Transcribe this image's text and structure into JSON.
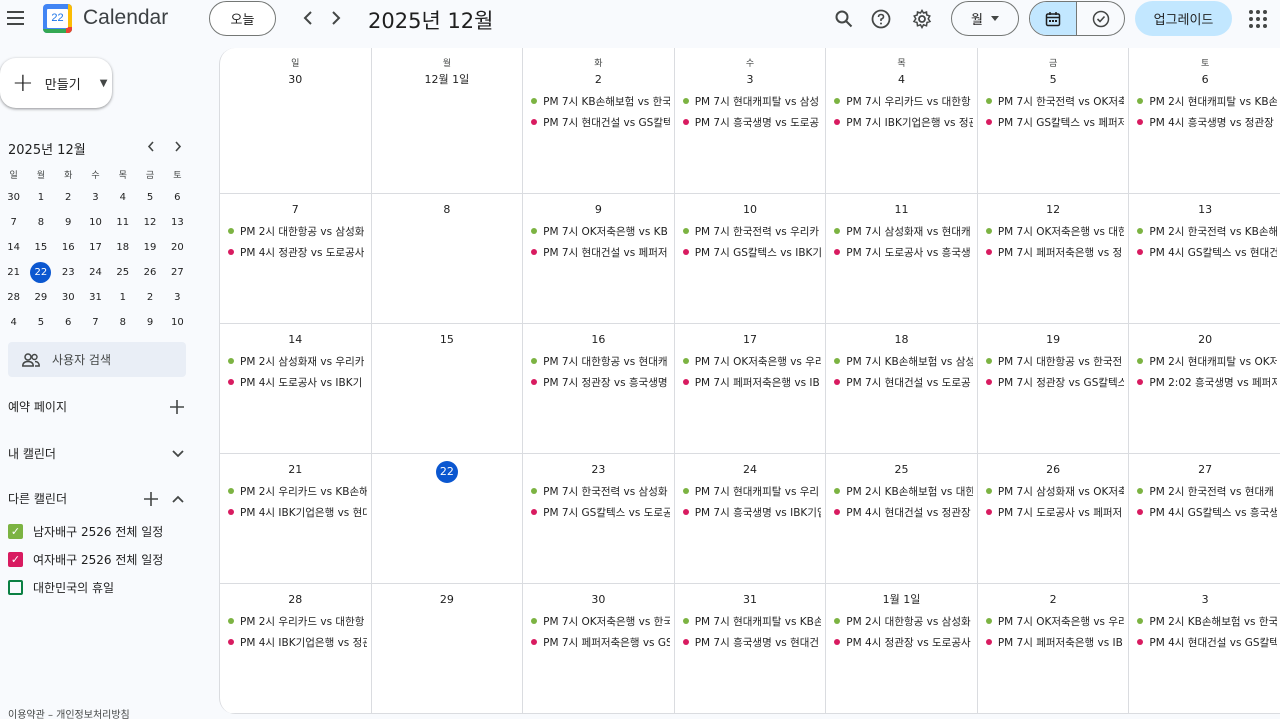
{
  "header": {
    "app_title": "Calendar",
    "logo_day": "22",
    "today_label": "오늘",
    "current_period": "2025년 12월",
    "view_label": "월",
    "upgrade_label": "업그레이드"
  },
  "sidebar": {
    "create_label": "만들기",
    "mini_title": "2025년 12월",
    "mini_weekdays": [
      "일",
      "월",
      "화",
      "수",
      "목",
      "금",
      "토"
    ],
    "mini_weeks": [
      [
        "30",
        "1",
        "2",
        "3",
        "4",
        "5",
        "6"
      ],
      [
        "7",
        "8",
        "9",
        "10",
        "11",
        "12",
        "13"
      ],
      [
        "14",
        "15",
        "16",
        "17",
        "18",
        "19",
        "20"
      ],
      [
        "21",
        "22",
        "23",
        "24",
        "25",
        "26",
        "27"
      ],
      [
        "28",
        "29",
        "30",
        "31",
        "1",
        "2",
        "3"
      ],
      [
        "4",
        "5",
        "6",
        "7",
        "8",
        "9",
        "10"
      ]
    ],
    "people_search": "사용자 검색",
    "booking_pages": "예약 페이지",
    "my_calendars": "내 캘린더",
    "other_calendars": "다른 캘린더",
    "calendars": [
      {
        "label": "남자배구 2526 전체 일정",
        "color": "#7cb342",
        "checked": true
      },
      {
        "label": "여자배구 2526 전체 일정",
        "color": "#d81b60",
        "checked": true
      },
      {
        "label": "대한민국의 휴일",
        "color": "#0b8043",
        "checked": false
      }
    ],
    "footer": "이용약관 – 개인정보처리방침"
  },
  "colors": {
    "men": "#7cb342",
    "women": "#d81b60",
    "accent": "#0b57d0"
  },
  "grid": {
    "weekdays": [
      "일",
      "월",
      "화",
      "수",
      "목",
      "금",
      "토"
    ],
    "weeks": [
      [
        {
          "date": "30",
          "events": []
        },
        {
          "date": "12월 1일",
          "events": []
        },
        {
          "date": "2",
          "events": [
            "PM 7시 KB손해보험 vs 한국",
            "PM 7시 현대건설 vs GS칼텍"
          ]
        },
        {
          "date": "3",
          "events": [
            "PM 7시 현대캐피탈 vs 삼성",
            "PM 7시 흥국생명 vs 도로공"
          ]
        },
        {
          "date": "4",
          "events": [
            "PM 7시 우리카드 vs 대한항",
            "PM 7시 IBK기업은행 vs 정관"
          ]
        },
        {
          "date": "5",
          "events": [
            "PM 7시 한국전력 vs OK저축",
            "PM 7시 GS칼텍스 vs 페퍼저"
          ]
        },
        {
          "date": "6",
          "events": [
            "PM 2시 현대캐피탈 vs KB손",
            "PM 4시 흥국생명 vs 정관장"
          ]
        }
      ],
      [
        {
          "date": "7",
          "events": [
            "PM 2시 대한항공 vs 삼성화",
            "PM 4시 정관장 vs 도로공사"
          ]
        },
        {
          "date": "8",
          "events": []
        },
        {
          "date": "9",
          "events": [
            "PM 7시 OK저축은행 vs KB",
            "PM 7시 현대건설 vs 페퍼저"
          ]
        },
        {
          "date": "10",
          "events": [
            "PM 7시 한국전력 vs 우리카",
            "PM 7시 GS칼텍스 vs IBK기"
          ]
        },
        {
          "date": "11",
          "events": [
            "PM 7시 삼성화재 vs 현대캐",
            "PM 7시 도로공사 vs 흥국생"
          ]
        },
        {
          "date": "12",
          "events": [
            "PM 7시 OK저축은행 vs 대한",
            "PM 7시 페퍼저축은행 vs 정"
          ]
        },
        {
          "date": "13",
          "events": [
            "PM 2시 한국전력 vs KB손해",
            "PM 4시 GS칼텍스 vs 현대건"
          ]
        }
      ],
      [
        {
          "date": "14",
          "events": [
            "PM 2시 삼성화재 vs 우리카",
            "PM 4시 도로공사 vs IBK기"
          ]
        },
        {
          "date": "15",
          "events": []
        },
        {
          "date": "16",
          "events": [
            "PM 7시 대한항공 vs 현대캐",
            "PM 7시 정관장 vs 흥국생명"
          ]
        },
        {
          "date": "17",
          "events": [
            "PM 7시 OK저축은행 vs 우리",
            "PM 7시 페퍼저축은행 vs IB"
          ]
        },
        {
          "date": "18",
          "events": [
            "PM 7시 KB손해보험 vs 삼성",
            "PM 7시 현대건설 vs 도로공"
          ]
        },
        {
          "date": "19",
          "events": [
            "PM 7시 대한항공 vs 한국전",
            "PM 7시 정관장 vs GS칼텍스"
          ]
        },
        {
          "date": "20",
          "events": [
            "PM 2시 현대캐피탈 vs OK저",
            "PM 2:02 흥국생명 vs 페퍼저"
          ]
        }
      ],
      [
        {
          "date": "21",
          "events": [
            "PM 2시 우리카드 vs KB손해",
            "PM 4시 IBK기업은행 vs 현대"
          ]
        },
        {
          "date": "22",
          "today": true,
          "events": []
        },
        {
          "date": "23",
          "events": [
            "PM 7시 한국전력 vs 삼성화",
            "PM 7시 GS칼텍스 vs 도로공"
          ]
        },
        {
          "date": "24",
          "events": [
            "PM 7시 현대캐피탈 vs 우리",
            "PM 7시 흥국생명 vs IBK기업"
          ]
        },
        {
          "date": "25",
          "events": [
            "PM 2시 KB손해보험 vs 대한",
            "PM 4시 현대건설 vs 정관장"
          ]
        },
        {
          "date": "26",
          "events": [
            "PM 7시 삼성화재 vs OK저축",
            "PM 7시 도로공사 vs 페퍼저"
          ]
        },
        {
          "date": "27",
          "events": [
            "PM 2시 한국전력 vs 현대캐",
            "PM 4시 GS칼텍스 vs 흥국생"
          ]
        }
      ],
      [
        {
          "date": "28",
          "events": [
            "PM 2시 우리카드 vs 대한항",
            "PM 4시 IBK기업은행 vs 정관"
          ]
        },
        {
          "date": "29",
          "events": []
        },
        {
          "date": "30",
          "events": [
            "PM 7시 OK저축은행 vs 한국",
            "PM 7시 페퍼저축은행 vs GS"
          ]
        },
        {
          "date": "31",
          "events": [
            "PM 7시 현대캐피탈 vs KB손",
            "PM 7시 흥국생명 vs 현대건"
          ]
        },
        {
          "date": "1월 1일",
          "events": [
            "PM 2시 대한항공 vs 삼성화",
            "PM 4시 정관장 vs 도로공사"
          ]
        },
        {
          "date": "2",
          "events": [
            "PM 7시 OK저축은행 vs 우리",
            "PM 7시 페퍼저축은행 vs IB"
          ]
        },
        {
          "date": "3",
          "events": [
            "PM 2시 KB손해보험 vs 한국",
            "PM 4시 현대건설 vs GS칼텍"
          ]
        }
      ]
    ]
  }
}
